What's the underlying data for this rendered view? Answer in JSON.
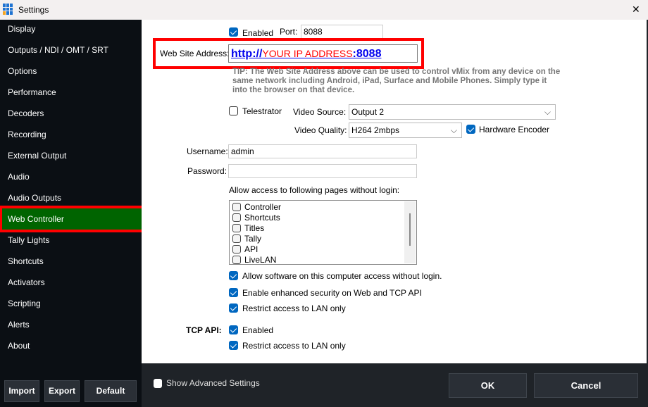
{
  "window": {
    "title": "Settings",
    "close": "✕"
  },
  "sidebar": {
    "items": [
      "Display",
      "Outputs / NDI / OMT / SRT",
      "Options",
      "Performance",
      "Decoders",
      "Recording",
      "External Output",
      "Audio",
      "Audio Outputs",
      "Web Controller",
      "Tally Lights",
      "Shortcuts",
      "Activators",
      "Scripting",
      "Alerts",
      "About"
    ],
    "active": "Web Controller",
    "import": "Import",
    "export": "Export",
    "default": "Default"
  },
  "web": {
    "enabled_label": "Enabled",
    "enabled": true,
    "port_label": "Port:",
    "port": "8088",
    "address_label": "Web Site Address:",
    "address_prefix": "http://",
    "address_ip": "YOUR IP ADDRESS",
    "address_suffix": ":8088",
    "tip": "TIP: The Web Site Address above can be used to control vMix from any device on the same network including Android, iPad, Surface and Mobile Phones. Simply type it into the browser on that device.",
    "telestrator_label": "Telestrator",
    "video_source_label": "Video Source:",
    "video_source": "Output 2",
    "video_quality_label": "Video Quality:",
    "video_quality": "H264 2mbps",
    "hardware_encoder_label": "Hardware Encoder",
    "username_label": "Username:",
    "username": "admin",
    "password_label": "Password:",
    "password": "",
    "pages_label": "Allow access to following pages without login:",
    "pages": [
      "Controller",
      "Shortcuts",
      "Titles",
      "Tally",
      "API",
      "LiveLAN"
    ],
    "allow_local": "Allow software on this computer access without login.",
    "enhanced_security": "Enable enhanced security on Web and TCP API",
    "restrict_lan": "Restrict access to LAN only"
  },
  "tcp": {
    "label": "TCP API:",
    "enabled_label": "Enabled",
    "restrict_lan": "Restrict access to LAN only"
  },
  "footer": {
    "show_advanced": "Show Advanced Settings",
    "ok": "OK",
    "cancel": "Cancel"
  },
  "colors": {
    "accent": "#0067c0",
    "active_sidebar": "#006400",
    "highlight": "#ff0000"
  }
}
